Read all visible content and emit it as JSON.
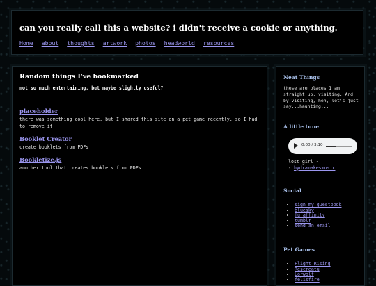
{
  "header": {
    "title": "can you really call this a website? i didn't receive a cookie or anything.",
    "nav": [
      "Home",
      "about",
      "thoughts",
      "artwork",
      "photos",
      "headworld",
      "resources"
    ]
  },
  "main": {
    "heading": "Random things I've bookmarked",
    "subheading": "not so much entertaining, but maybe slightly useful?",
    "entries": [
      {
        "title": "placeholder",
        "desc": "there was something cool here, but I shared this site on a pet game recently, so I had to remove it."
      },
      {
        "title": "Booklet Creator",
        "desc": "create booklets from PDFs"
      },
      {
        "title": "Bookletize.js",
        "desc": "another tool that creates booklets from PDFs"
      }
    ]
  },
  "sidebar": {
    "neat": {
      "heading": "Neat Things",
      "text": "these are places I am straight up, visiting. And by visiting, heh, let's just say...haunting..."
    },
    "tune": {
      "heading": "A little tune",
      "player_time": "0:00 / 3:10",
      "song_title": "lost girl -",
      "song_artist": "hydramakesmusic"
    },
    "social": {
      "heading": "Social",
      "links": [
        "sign my guestbook",
        "bluesky",
        "furaffinity",
        "tumblr",
        "send an email"
      ]
    },
    "pet_games": {
      "heading": "Pet Games",
      "links": [
        "Flight Rising",
        "Rescreatu",
        "Lorwolf",
        "felisfire"
      ]
    }
  },
  "colors": {
    "link": "#9b96ef",
    "side_heading": "#a9c0ea",
    "panel": "#000000"
  }
}
